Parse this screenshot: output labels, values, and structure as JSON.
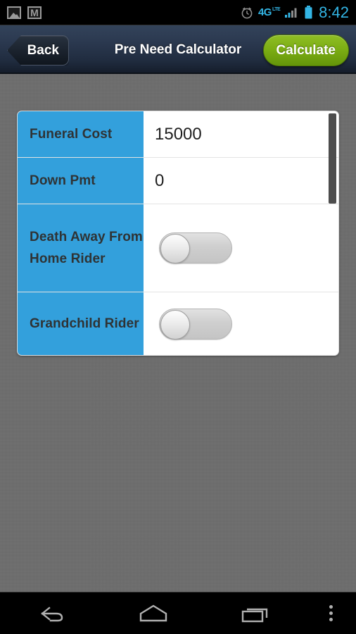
{
  "statusbar": {
    "left_icons": [
      "gallery-icon",
      "gmail-icon"
    ],
    "right_icons": [
      "alarm-clock-icon",
      "4g-lte-icon",
      "signal-bars-icon",
      "battery-icon"
    ],
    "network_label": "4G",
    "network_sub": "LTE",
    "time": "8:42",
    "accent_color": "#33b5e5"
  },
  "header": {
    "back_label": "Back",
    "title": "Pre Need Calculator",
    "calculate_label": "Calculate",
    "calculate_color": "#7cae14",
    "background_color": "#2b3950"
  },
  "form": {
    "label_color": "#33a0dc",
    "rows": [
      {
        "label": "Funeral Cost",
        "type": "text",
        "value": "15000"
      },
      {
        "label": "Down Pmt",
        "type": "text",
        "value": "0"
      },
      {
        "label": "Death Away From Home Rider",
        "type": "toggle",
        "value": "off"
      },
      {
        "label": "Grandchild Rider",
        "type": "toggle",
        "value": "off"
      }
    ]
  },
  "navbar": {
    "items": [
      {
        "name": "back-nav-icon"
      },
      {
        "name": "home-nav-icon"
      },
      {
        "name": "recent-apps-nav-icon"
      },
      {
        "name": "overflow-menu-icon"
      }
    ]
  },
  "background": {
    "color": "#6d6d6d"
  }
}
